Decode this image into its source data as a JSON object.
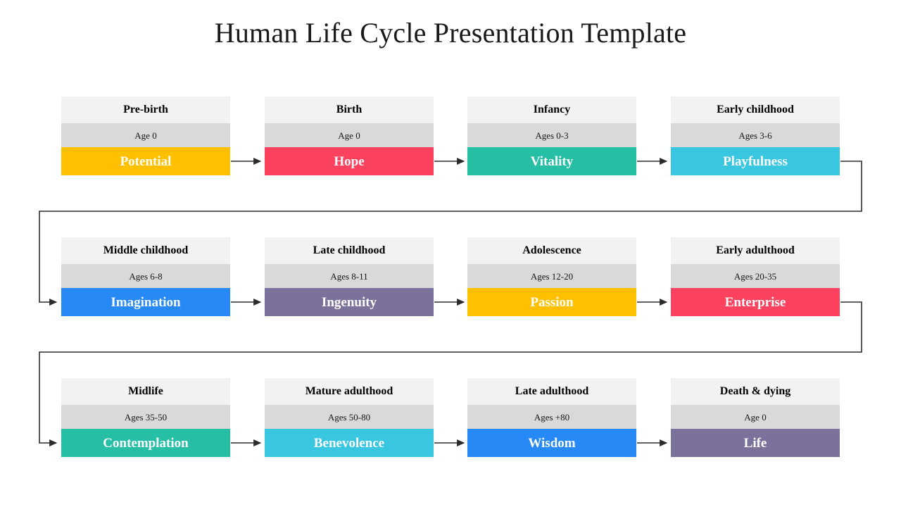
{
  "slide": {
    "title": "Human Life Cycle Presentation Template",
    "background_color": "#ffffff",
    "title_color": "#1a1a1a"
  },
  "theme": {
    "card_title_bg": "#f2f2f2",
    "card_age_bg": "#d9d9d9",
    "card_title_text": "#000000",
    "card_age_text": "#171717",
    "trait_text": "#ffffff",
    "connector_color": "#3b3b3b"
  },
  "palette": {
    "amber": "#ffc000",
    "crimson": "#fc425f",
    "teal": "#26bfa5",
    "cyan": "#38c6e0",
    "blue": "#2689f5",
    "purple": "#7c719a"
  },
  "chart_data": {
    "type": "diagram",
    "title": "Human Life Cycle Presentation Template",
    "layout": "3 rows x 4 columns, serpentine flow left-to-right then wrapping",
    "stages": [
      {
        "index": 1,
        "stage": "Pre-birth",
        "age": "Age 0",
        "trait": "Potential",
        "color": "#ffc000"
      },
      {
        "index": 2,
        "stage": "Birth",
        "age": "Age 0",
        "trait": "Hope",
        "color": "#fc425f"
      },
      {
        "index": 3,
        "stage": "Infancy",
        "age": "Ages 0-3",
        "trait": "Vitality",
        "color": "#26bfa5"
      },
      {
        "index": 4,
        "stage": "Early childhood",
        "age": "Ages 3-6",
        "trait": "Playfulness",
        "color": "#38c6e0"
      },
      {
        "index": 5,
        "stage": "Middle childhood",
        "age": "Ages 6-8",
        "trait": "Imagination",
        "color": "#2689f5"
      },
      {
        "index": 6,
        "stage": "Late childhood",
        "age": "Ages 8-11",
        "trait": "Ingenuity",
        "color": "#7c719a"
      },
      {
        "index": 7,
        "stage": "Adolescence",
        "age": "Ages 12-20",
        "trait": "Passion",
        "color": "#ffc000"
      },
      {
        "index": 8,
        "stage": "Early adulthood",
        "age": "Ages 20-35",
        "trait": "Enterprise",
        "color": "#fc425f"
      },
      {
        "index": 9,
        "stage": "Midlife",
        "age": "Ages 35-50",
        "trait": "Contemplation",
        "color": "#26bfa5"
      },
      {
        "index": 10,
        "stage": "Mature adulthood",
        "age": "Ages 50-80",
        "trait": "Benevolence",
        "color": "#38c6e0"
      },
      {
        "index": 11,
        "stage": "Late adulthood",
        "age": "Ages +80",
        "trait": "Wisdom",
        "color": "#2689f5"
      },
      {
        "index": 12,
        "stage": "Death & dying",
        "age": "Age 0",
        "trait": "Life",
        "color": "#7c719a"
      }
    ]
  },
  "rows": [
    {
      "cards": [
        {
          "stage": "Pre-birth",
          "age": "Age 0",
          "trait": "Potential",
          "color": "#ffc000"
        },
        {
          "stage": "Birth",
          "age": "Age 0",
          "trait": "Hope",
          "color": "#fc425f"
        },
        {
          "stage": "Infancy",
          "age": "Ages 0-3",
          "trait": "Vitality",
          "color": "#26bfa5"
        },
        {
          "stage": "Early childhood",
          "age": "Ages 3-6",
          "trait": "Playfulness",
          "color": "#38c6e0"
        }
      ]
    },
    {
      "cards": [
        {
          "stage": "Middle childhood",
          "age": "Ages 6-8",
          "trait": "Imagination",
          "color": "#2689f5"
        },
        {
          "stage": "Late childhood",
          "age": "Ages 8-11",
          "trait": "Ingenuity",
          "color": "#7c719a"
        },
        {
          "stage": "Adolescence",
          "age": "Ages 12-20",
          "trait": "Passion",
          "color": "#ffc000"
        },
        {
          "stage": "Early adulthood",
          "age": "Ages 20-35",
          "trait": "Enterprise",
          "color": "#fc425f"
        }
      ]
    },
    {
      "cards": [
        {
          "stage": "Midlife",
          "age": "Ages 35-50",
          "trait": "Contemplation",
          "color": "#26bfa5"
        },
        {
          "stage": "Mature adulthood",
          "age": "Ages 50-80",
          "trait": "Benevolence",
          "color": "#38c6e0"
        },
        {
          "stage": "Late adulthood",
          "age": "Ages +80",
          "trait": "Wisdom",
          "color": "#2689f5"
        },
        {
          "stage": "Death & dying",
          "age": "Age 0",
          "trait": "Life",
          "color": "#7c719a"
        }
      ]
    }
  ]
}
